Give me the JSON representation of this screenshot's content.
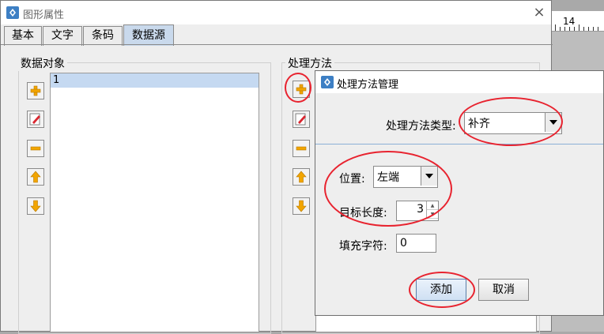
{
  "ruler": {
    "number": "14"
  },
  "window": {
    "title": "图形属性",
    "close": "×",
    "tabs": [
      {
        "label": "基本"
      },
      {
        "label": "文字"
      },
      {
        "label": "条码"
      },
      {
        "label": "数据源"
      }
    ]
  },
  "data_object": {
    "group_label": "数据对象",
    "items": [
      "1"
    ]
  },
  "process_method": {
    "group_label": "处理方法"
  },
  "dialog": {
    "title": "处理方法管理",
    "type_label": "处理方法类型:",
    "type_value": "补齐",
    "position_label": "位置:",
    "position_value": "左端",
    "target_length_label": "目标长度:",
    "target_length_value": "3",
    "fill_char_label": "填充字符:",
    "fill_char_value": "0",
    "add_button": "添加",
    "cancel_button": "取消"
  },
  "colors": {
    "annotation": "#e8232f",
    "selection": "#c5d9f1",
    "active_tab": "#c9d9ec"
  }
}
